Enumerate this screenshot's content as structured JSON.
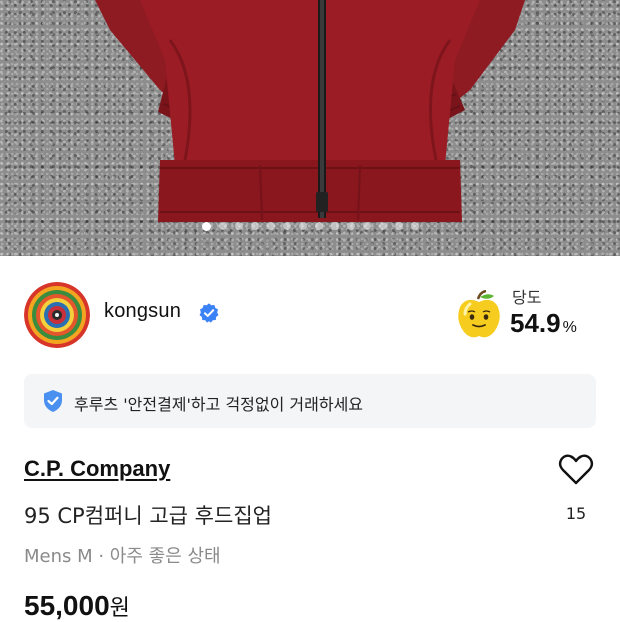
{
  "photo": {
    "slides_total": 14,
    "active_slide": 1
  },
  "seller": {
    "name": "kongsun",
    "verified": true,
    "sweetness_label": "당도",
    "sweetness_value": "54.9",
    "sweetness_unit": "%"
  },
  "banner": {
    "text": "후루츠 '안전결제'하고 걱정없이 거래하세요"
  },
  "product": {
    "brand": "C.P. Company",
    "title": "95 CP컴퍼니 고급 후드집업",
    "meta": "Mens M · 아주 좋은 상태",
    "price": "55,000",
    "price_unit": "원",
    "like_count": "15"
  },
  "colors": {
    "accent_blue": "#3b82f6",
    "jacket_red": "#9b1c24",
    "banner_bg": "#f4f5f7",
    "meta_gray": "#8a8a8a"
  },
  "icons": {
    "verified": "verified-badge-icon",
    "sweetness": "apple-face-icon",
    "banner": "shield-check-icon",
    "like": "heart-outline-icon"
  }
}
